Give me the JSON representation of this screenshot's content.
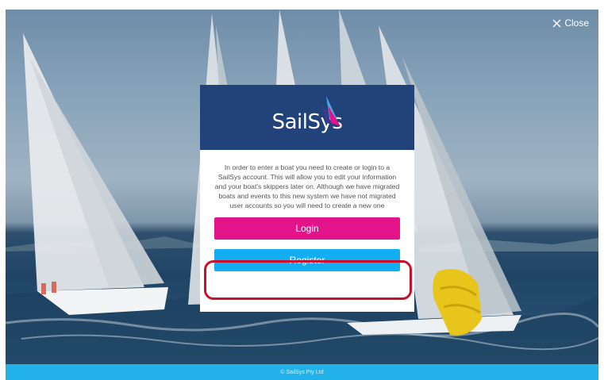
{
  "close": {
    "label": "Close"
  },
  "modal": {
    "logo": "SailSys",
    "message": "In order to enter a boat you need to create or login to a SailSys account. This will allow you to edit your information and your boat's skippers later on. Although we have migrated boats and events to this new system we have not migrated user accounts so you will need to create a new one",
    "login_label": "Login",
    "register_label": "Register"
  },
  "footer": {
    "copyright": "© SailSys Pty Ltd"
  },
  "colors": {
    "header": "#22427a",
    "login": "#e3138a",
    "register": "#12aef1",
    "footer": "#22b1e8",
    "highlight": "#c8102e"
  }
}
